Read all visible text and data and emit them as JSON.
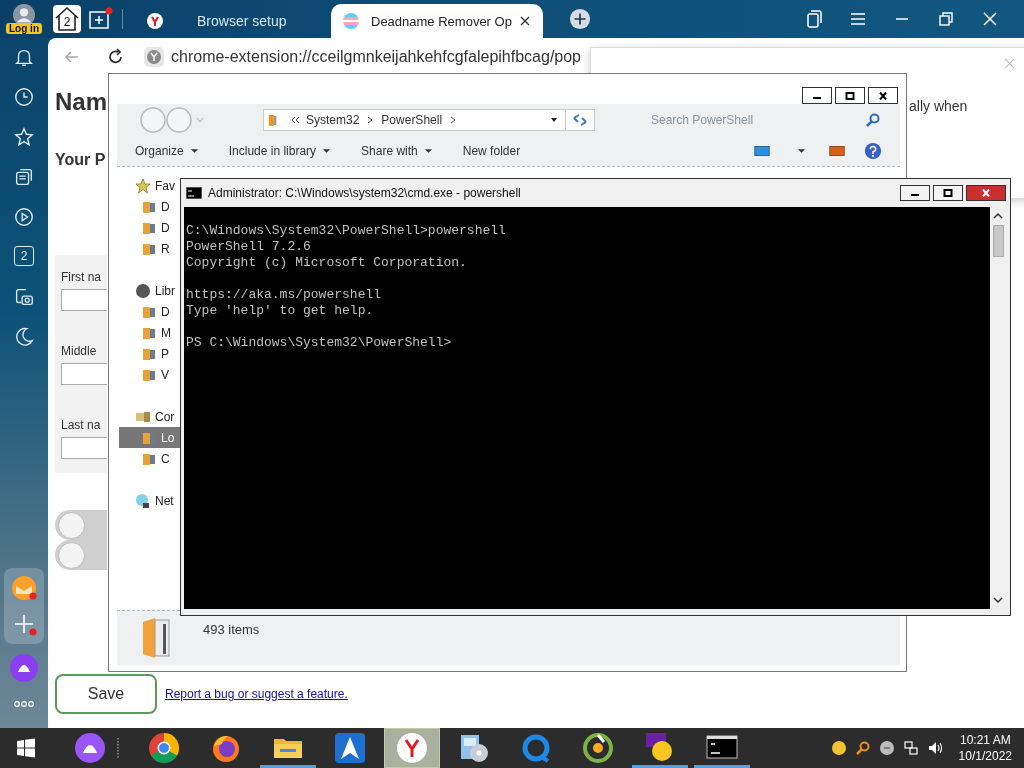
{
  "browser": {
    "login_label": "Log in",
    "home_count": "2",
    "sidebar_badge": "2",
    "tabs": [
      {
        "label": "Browser setup",
        "selected": false
      },
      {
        "label": "Deadname Remover Op",
        "selected": true
      }
    ],
    "address": "chrome-extension://cceilgmnkeijahkehfcgfalepihfbcag/pop"
  },
  "page": {
    "heading": "Nam",
    "subheading": "Your P",
    "fields": [
      {
        "label": "First na"
      },
      {
        "label": "Middle"
      },
      {
        "label": "Last na"
      }
    ],
    "toggles": [
      {
        "on": false
      },
      {
        "on": false
      }
    ],
    "save_button": "Save",
    "report_link": "Report a bug or suggest a feature."
  },
  "popup": {
    "text": "ally when"
  },
  "explorer": {
    "path": [
      "System32",
      "PowerShell"
    ],
    "search": {
      "placeholder": "Search PowerShell"
    },
    "toolbar": [
      {
        "label": "Organize",
        "dropdown": true
      },
      {
        "label": "Include in library",
        "dropdown": true
      },
      {
        "label": "Share with",
        "dropdown": true
      },
      {
        "label": "New folder",
        "dropdown": false
      }
    ],
    "nav": [
      {
        "label": "Fav",
        "selected": false,
        "children": [
          {
            "label": "D",
            "selected": false
          },
          {
            "label": "D",
            "selected": false
          },
          {
            "label": "R",
            "selected": false
          }
        ]
      },
      {
        "label": "Libr",
        "selected": false,
        "children": [
          {
            "label": "D",
            "selected": false
          },
          {
            "label": "M",
            "selected": false
          },
          {
            "label": "P",
            "selected": false
          },
          {
            "label": "V",
            "selected": false
          }
        ]
      },
      {
        "label": "Cor",
        "selected": false,
        "children": [
          {
            "label": "Lo",
            "selected": true
          },
          {
            "label": "C",
            "selected": false
          }
        ]
      },
      {
        "label": "Net",
        "selected": false
      }
    ],
    "status": "493 items"
  },
  "cmd": {
    "title": "Administrator: C:\\Windows\\system32\\cmd.exe - powershell",
    "blocks": [
      [
        "C:\\Windows\\System32\\PowerShell>powershell",
        "PowerShell 7.2.6",
        "Copyright (c) Microsoft Corporation."
      ],
      [
        "https://aka.ms/powershell",
        "Type 'help' to get help."
      ],
      [
        "PS C:\\Windows\\System32\\PowerShell>"
      ]
    ]
  },
  "taskbar": {
    "apps": [
      {
        "kind": "assistant",
        "running": false,
        "selected": false
      },
      {
        "kind": "chrome",
        "running": false,
        "selected": false
      },
      {
        "kind": "firefox",
        "running": false,
        "selected": false
      },
      {
        "kind": "folder",
        "running": true,
        "selected": false
      },
      {
        "kind": "arrow",
        "running": false,
        "selected": false
      },
      {
        "kind": "yandex",
        "running": false,
        "selected": true
      },
      {
        "kind": "media",
        "running": false,
        "selected": false
      },
      {
        "kind": "ring",
        "running": false,
        "selected": false
      },
      {
        "kind": "green",
        "running": false,
        "selected": false
      },
      {
        "kind": "yahoo",
        "running": true,
        "selected": false
      },
      {
        "kind": "console",
        "running": true,
        "selected": false
      }
    ],
    "time": "10:21 AM",
    "date": "10/1/2022"
  }
}
